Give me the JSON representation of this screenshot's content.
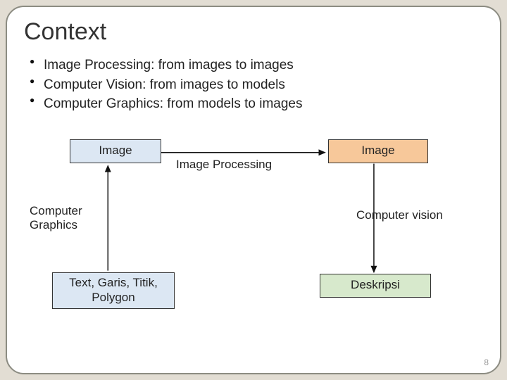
{
  "title": "Context",
  "bullets": [
    "Image Processing: from images to images",
    "Computer Vision: from images to models",
    "Computer Graphics: from models to images"
  ],
  "diagram": {
    "boxes": {
      "image_left": "Image",
      "image_right": "Image",
      "primitives": "Text, Garis, Titik, Polygon",
      "description": "Deskripsi"
    },
    "labels": {
      "image_processing": "Image Processing",
      "computer_graphics": "Computer\nGraphics",
      "computer_vision": "Computer vision"
    }
  },
  "page_number": "8"
}
